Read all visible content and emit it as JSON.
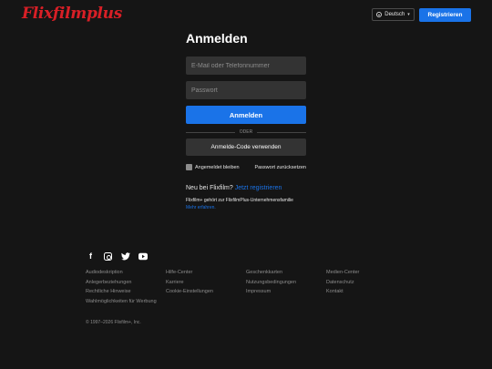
{
  "header": {
    "logo": "Flixfilmplus",
    "language": "Deutsch",
    "register_label": "Registrieren"
  },
  "login": {
    "title": "Anmelden",
    "email_placeholder": "E-Mail oder Telefonnummer",
    "password_placeholder": "Passwort",
    "submit_label": "Anmelden",
    "divider": "ODER",
    "code_label": "Anmelde-Code verwenden",
    "remember_label": "Angemeldet bleiben",
    "forgot_label": "Passwort zurücksetzen",
    "new_prefix": "Neu bei Flixfilm?",
    "new_link": "Jetzt registrieren",
    "family_text": "Flixfilm+ gehört zur FlixfilmPlus-Unternehmensfamilie",
    "family_link": "Mehr erfahren."
  },
  "footer": {
    "social_icons": [
      "facebook-icon",
      "instagram-icon",
      "twitter-icon",
      "youtube-icon"
    ],
    "links": [
      "Audiodeskription",
      "Hilfe-Center",
      "Geschenkkarten",
      "Medien-Center",
      "Anlegerbeziehungen",
      "Karriere",
      "Nutzungsbedingungen",
      "Datenschutz",
      "Rechtliche Hinweise",
      "Cookie-Einstellungen",
      "Impressum",
      "Kontakt",
      "Wahlmöglichkeiten für Werbung"
    ],
    "copyright": "© 1997–2026 Flixfilm+, Inc."
  },
  "colors": {
    "background": "#151515",
    "brand": "#d81f26",
    "accent": "#1a73e8",
    "field": "#333333",
    "muted": "#8c8c8c"
  }
}
